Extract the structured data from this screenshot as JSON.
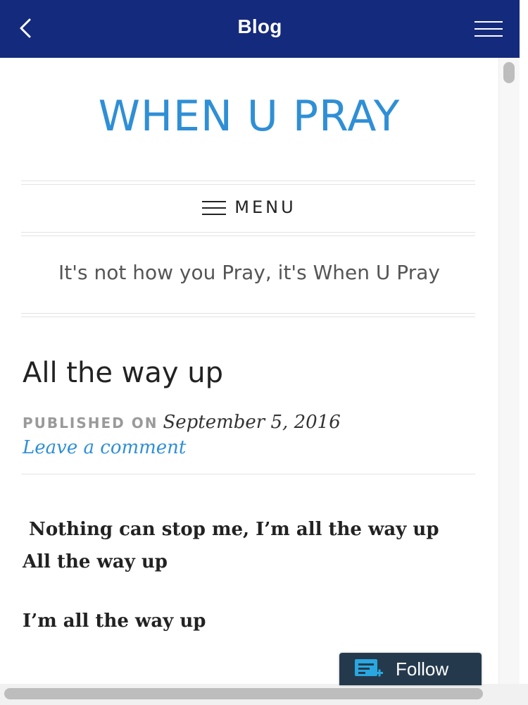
{
  "app_bar": {
    "title": "Blog",
    "back_icon": "chevron-left-icon",
    "menu_icon": "hamburger-icon",
    "background": "#142a7c"
  },
  "site": {
    "title": "WHEN U PRAY",
    "title_color": "#2f8fd6",
    "menu_label": "MENU",
    "tagline": "It's not how you Pray, it's When U Pray"
  },
  "post": {
    "title": "All the way up",
    "published_label": "PUBLISHED ON",
    "date": "September 5, 2016",
    "comment_link": "Leave a comment",
    "lines": [
      " Nothing can stop me, I’m all the way up",
      "All the way up",
      "I’m all the way up"
    ]
  },
  "follow_button": {
    "label": "Follow",
    "icon": "reader-follow-icon",
    "accent": "#2aa7e0"
  }
}
